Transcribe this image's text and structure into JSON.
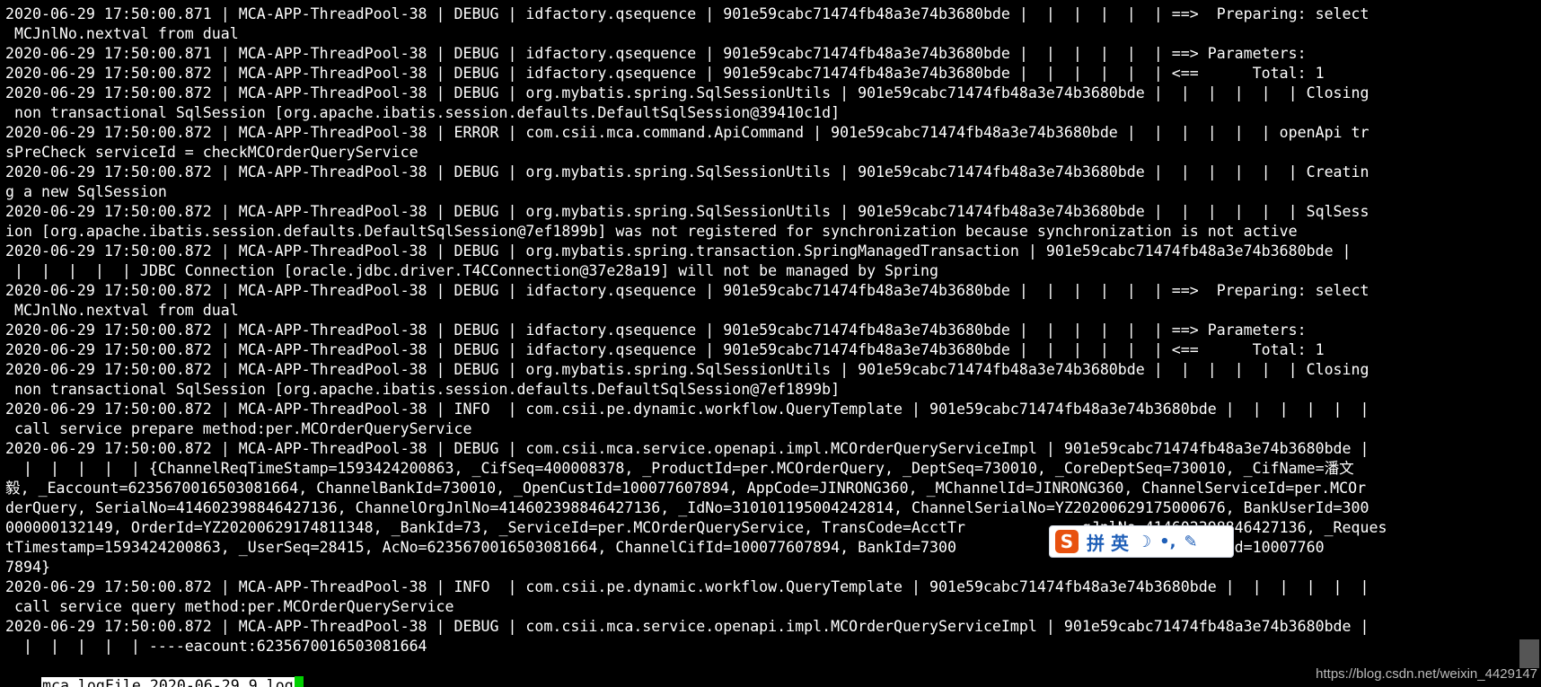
{
  "log_lines": [
    "2020-06-29 17:50:00.871 | MCA-APP-ThreadPool-38 | DEBUG | idfactory.qsequence | 901e59cabc71474fb48a3e74b3680bde |  |  |  |  |  | ==>  Preparing: select",
    " MCJnlNo.nextval from dual",
    "2020-06-29 17:50:00.871 | MCA-APP-ThreadPool-38 | DEBUG | idfactory.qsequence | 901e59cabc71474fb48a3e74b3680bde |  |  |  |  |  | ==> Parameters:",
    "2020-06-29 17:50:00.872 | MCA-APP-ThreadPool-38 | DEBUG | idfactory.qsequence | 901e59cabc71474fb48a3e74b3680bde |  |  |  |  |  | <==      Total: 1",
    "2020-06-29 17:50:00.872 | MCA-APP-ThreadPool-38 | DEBUG | org.mybatis.spring.SqlSessionUtils | 901e59cabc71474fb48a3e74b3680bde |  |  |  |  |  | Closing",
    " non transactional SqlSession [org.apache.ibatis.session.defaults.DefaultSqlSession@39410c1d]",
    "2020-06-29 17:50:00.872 | MCA-APP-ThreadPool-38 | ERROR | com.csii.mca.command.ApiCommand | 901e59cabc71474fb48a3e74b3680bde |  |  |  |  |  | openApi tr",
    "sPreCheck serviceId = checkMCOrderQueryService",
    "2020-06-29 17:50:00.872 | MCA-APP-ThreadPool-38 | DEBUG | org.mybatis.spring.SqlSessionUtils | 901e59cabc71474fb48a3e74b3680bde |  |  |  |  |  | Creatin",
    "g a new SqlSession",
    "2020-06-29 17:50:00.872 | MCA-APP-ThreadPool-38 | DEBUG | org.mybatis.spring.SqlSessionUtils | 901e59cabc71474fb48a3e74b3680bde |  |  |  |  |  | SqlSess",
    "ion [org.apache.ibatis.session.defaults.DefaultSqlSession@7ef1899b] was not registered for synchronization because synchronization is not active",
    "2020-06-29 17:50:00.872 | MCA-APP-ThreadPool-38 | DEBUG | org.mybatis.spring.transaction.SpringManagedTransaction | 901e59cabc71474fb48a3e74b3680bde |",
    " |  |  |  |  | JDBC Connection [oracle.jdbc.driver.T4CConnection@37e28a19] will not be managed by Spring",
    "2020-06-29 17:50:00.872 | MCA-APP-ThreadPool-38 | DEBUG | idfactory.qsequence | 901e59cabc71474fb48a3e74b3680bde |  |  |  |  |  | ==>  Preparing: select",
    " MCJnlNo.nextval from dual",
    "2020-06-29 17:50:00.872 | MCA-APP-ThreadPool-38 | DEBUG | idfactory.qsequence | 901e59cabc71474fb48a3e74b3680bde |  |  |  |  |  | ==> Parameters:",
    "2020-06-29 17:50:00.872 | MCA-APP-ThreadPool-38 | DEBUG | idfactory.qsequence | 901e59cabc71474fb48a3e74b3680bde |  |  |  |  |  | <==      Total: 1",
    "2020-06-29 17:50:00.872 | MCA-APP-ThreadPool-38 | DEBUG | org.mybatis.spring.SqlSessionUtils | 901e59cabc71474fb48a3e74b3680bde |  |  |  |  |  | Closing",
    " non transactional SqlSession [org.apache.ibatis.session.defaults.DefaultSqlSession@7ef1899b]",
    "2020-06-29 17:50:00.872 | MCA-APP-ThreadPool-38 | INFO  | com.csii.pe.dynamic.workflow.QueryTemplate | 901e59cabc71474fb48a3e74b3680bde |  |  |  |  |  |",
    " call service prepare method:per.MCOrderQueryService",
    "2020-06-29 17:50:00.872 | MCA-APP-ThreadPool-38 | DEBUG | com.csii.mca.service.openapi.impl.MCOrderQueryServiceImpl | 901e59cabc71474fb48a3e74b3680bde |",
    "  |  |  |  |  | {ChannelReqTimeStamp=1593424200863, _CifSeq=400008378, _ProductId=per.MCOrderQuery, _DeptSeq=730010, _CoreDeptSeq=730010, _CifName=潘文",
    "毅, _Eaccount=6235670016503081664, ChannelBankId=730010, _OpenCustId=100077607894, AppCode=JINRONG360, _MChannelId=JINRONG360, ChannelServiceId=per.MCOr",
    "derQuery, SerialNo=414602398846427136, ChannelOrgJnlNo=414602398846427136, _IdNo=310101195004242814, ChannelSerialNo=YZ20200629175000676, BankUserId=300",
    "000000132149, OrderId=YZ20200629174811348, _BankId=73, _ServiceId=per.MCOrderQueryService, TransCode=AcctTr             gJnlNo=414602398846427136, _Reques",
    "tTimestamp=1593424200863, _UserSeq=28415, AcNo=6235670016503081664, ChannelCifId=100077607894, BankId=7300             RONG360, OpenUserId=10007760",
    "7894}",
    "2020-06-29 17:50:00.872 | MCA-APP-ThreadPool-38 | INFO  | com.csii.pe.dynamic.workflow.QueryTemplate | 901e59cabc71474fb48a3e74b3680bde |  |  |  |  |  |",
    " call service query method:per.MCOrderQueryService",
    "2020-06-29 17:50:00.872 | MCA-APP-ThreadPool-38 | DEBUG | com.csii.mca.service.openapi.impl.MCOrderQueryServiceImpl | 901e59cabc71474fb48a3e74b3680bde |",
    "  |  |  |  |  | ----eacount:6235670016503081664"
  ],
  "status": {
    "filename": "mca.logFile.2020-06-29.9.log"
  },
  "ime_toolbar": {
    "logo": "S",
    "label": "拼 英",
    "icons": [
      "moon-icon",
      "punctuation-icon",
      "wrench-icon"
    ],
    "accent": "#e8510f",
    "text_color": "#1f5fb8"
  },
  "watermark": "https://blog.csdn.net/weixin_4429147",
  "colors": {
    "background": "#000000",
    "foreground": "#ffffff",
    "cursor": "#00d000"
  }
}
